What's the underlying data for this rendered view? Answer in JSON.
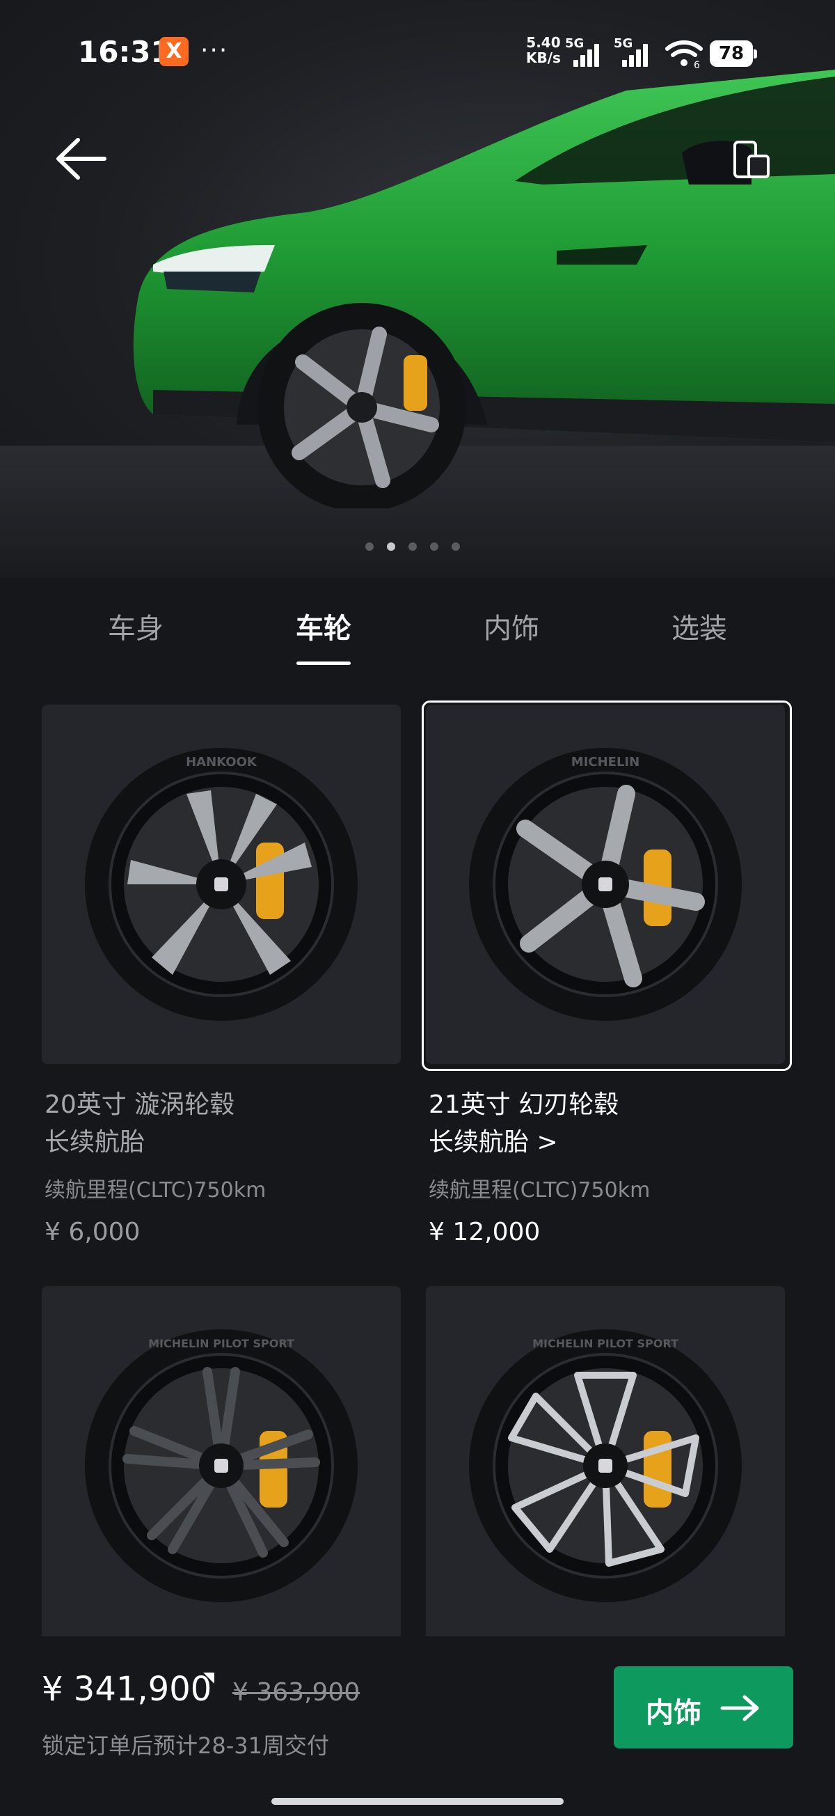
{
  "status_bar": {
    "time": "16:31",
    "app_badge": "X",
    "more": "···",
    "net_speed_value": "5.40",
    "net_speed_unit": "KB/s",
    "sim1": "5G",
    "sim2": "5G",
    "wifi_sub": "6",
    "battery": "78"
  },
  "hero": {
    "car_color": "#22a43a",
    "caliper_color": "#e6a21a",
    "image_count": 5,
    "active_image": 2
  },
  "tabs": [
    {
      "label": "车身",
      "active": false
    },
    {
      "label": "车轮",
      "active": true
    },
    {
      "label": "内饰",
      "active": false
    },
    {
      "label": "选装",
      "active": false
    }
  ],
  "wheels": [
    {
      "title_line1": "20英寸 漩涡轮毂",
      "title_line2": "长续航胎",
      "range": "续航里程(CLTC)750km",
      "price": "¥ 6,000",
      "selected": false,
      "tire_brand": "HANKOOK"
    },
    {
      "title_line1": "21英寸 幻刃轮毂",
      "title_line2": "长续航胎 >",
      "range": "续航里程(CLTC)750km",
      "price": "¥ 12,000",
      "selected": true,
      "tire_brand": "MICHELIN"
    },
    {
      "selected": false,
      "tire_brand": "MICHELIN PILOT SPORT"
    },
    {
      "selected": false,
      "tire_brand": "MICHELIN PILOT SPORT"
    }
  ],
  "bottom_bar": {
    "total_price": "¥ 341,900",
    "original_price": "¥ 363,900",
    "delivery_note": "锁定订单后预计28-31周交付",
    "next_button_label": "内饰"
  },
  "colors": {
    "background": "#16171b",
    "card": "#24262b",
    "accent_green": "#0e9a5e"
  }
}
